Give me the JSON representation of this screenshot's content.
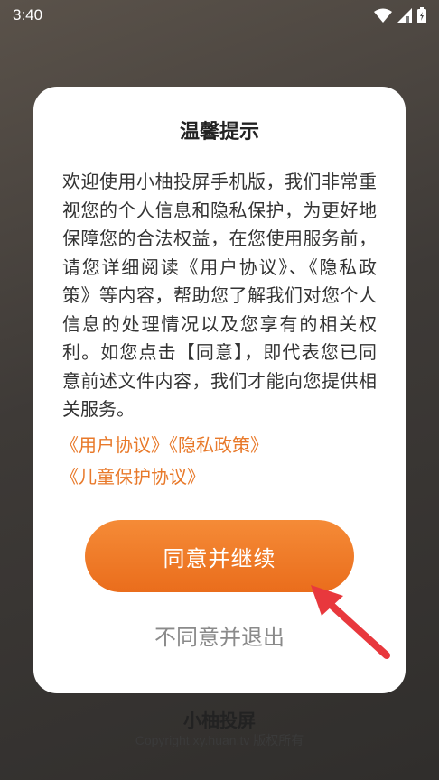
{
  "status_bar": {
    "time": "3:40",
    "icons": [
      "wifi-icon",
      "cellular-signal-icon",
      "battery-icon"
    ]
  },
  "dialog": {
    "title": "温馨提示",
    "body": "欢迎使用小柚投屏手机版，我们非常重视您的个人信息和隐私保护，为更好地保障您的合法权益，在您使用服务前，请您详细阅读《用户协议》、《隐私政策》等内容，帮助您了解我们对您个人信息的处理情况以及您享有的相关权利。如您点击【同意】，即代表您已同意前述文件内容，我们才能向您提供相关服务。",
    "links": {
      "user_agreement": "《用户协议》",
      "privacy_policy": "《隐私政策》",
      "child_protection": "《儿童保护协议》"
    },
    "agree_label": "同意并继续",
    "decline_label": "不同意并退出"
  },
  "footer": {
    "app_name": "小柚投屏",
    "copyright": "Copyright xy.huan.tv 版权所有"
  },
  "colors": {
    "accent": "#ea6d1c",
    "link": "#e8792a",
    "arrow": "#e8383d"
  }
}
